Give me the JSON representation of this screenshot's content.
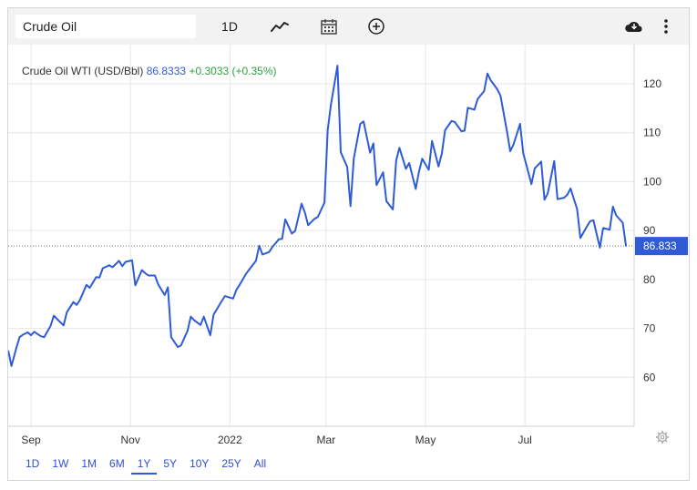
{
  "toolbar": {
    "symbol_value": "Crude Oil",
    "interval_label": "1D",
    "icons": [
      "line-chart-icon",
      "calendar-icon",
      "plus-circle-icon",
      "cloud-download-icon",
      "more-vertical-icon"
    ]
  },
  "legend": {
    "name": "Crude Oil WTI (USD/Bbl)",
    "price": "86.8333",
    "change": "+0.3033 (+0.35%)"
  },
  "last_price_label": "86.833",
  "ranges": [
    {
      "label": "1D",
      "active": false
    },
    {
      "label": "1W",
      "active": false
    },
    {
      "label": "1M",
      "active": false
    },
    {
      "label": "6M",
      "active": false
    },
    {
      "label": "1Y",
      "active": true
    },
    {
      "label": "5Y",
      "active": false
    },
    {
      "label": "10Y",
      "active": false
    },
    {
      "label": "25Y",
      "active": false
    },
    {
      "label": "All",
      "active": false
    }
  ],
  "colors": {
    "line": "#2f5cd6",
    "accent": "#2f5cd6",
    "positive": "#2ea043",
    "grid": "#e6e6e6"
  },
  "chart_data": {
    "type": "line",
    "title": "Crude Oil WTI (USD/Bbl)",
    "xlabel": "",
    "ylabel": "",
    "ylim": [
      50,
      128
    ],
    "y_ticks": [
      60,
      70,
      80,
      90,
      100,
      110,
      120
    ],
    "x_ticks": [
      {
        "date": "2021-09-01",
        "label": "Sep"
      },
      {
        "date": "2021-11-01",
        "label": "Nov"
      },
      {
        "date": "2022-01-01",
        "label": "2022"
      },
      {
        "date": "2022-03-01",
        "label": "Mar"
      },
      {
        "date": "2022-05-01",
        "label": "May"
      },
      {
        "date": "2022-07-01",
        "label": "Jul"
      }
    ],
    "grid": true,
    "last_value": 86.833,
    "series": [
      {
        "points": [
          [
            "2021-08-18",
            65.5
          ],
          [
            "2021-08-20",
            62.3
          ],
          [
            "2021-08-23",
            66.0
          ],
          [
            "2021-08-25",
            68.2
          ],
          [
            "2021-08-27",
            68.7
          ],
          [
            "2021-08-30",
            69.2
          ],
          [
            "2021-09-01",
            68.6
          ],
          [
            "2021-09-03",
            69.3
          ],
          [
            "2021-09-07",
            68.4
          ],
          [
            "2021-09-09",
            68.2
          ],
          [
            "2021-09-13",
            70.5
          ],
          [
            "2021-09-15",
            72.6
          ],
          [
            "2021-09-17",
            71.9
          ],
          [
            "2021-09-21",
            70.6
          ],
          [
            "2021-09-23",
            73.3
          ],
          [
            "2021-09-27",
            75.4
          ],
          [
            "2021-09-29",
            74.8
          ],
          [
            "2021-10-01",
            75.8
          ],
          [
            "2021-10-05",
            78.9
          ],
          [
            "2021-10-07",
            78.3
          ],
          [
            "2021-10-11",
            80.5
          ],
          [
            "2021-10-13",
            80.4
          ],
          [
            "2021-10-15",
            82.3
          ],
          [
            "2021-10-19",
            82.9
          ],
          [
            "2021-10-21",
            82.5
          ],
          [
            "2021-10-25",
            83.8
          ],
          [
            "2021-10-27",
            82.7
          ],
          [
            "2021-10-29",
            83.6
          ],
          [
            "2021-11-02",
            83.9
          ],
          [
            "2021-11-04",
            78.8
          ],
          [
            "2021-11-08",
            81.9
          ],
          [
            "2021-11-10",
            81.3
          ],
          [
            "2021-11-12",
            80.8
          ],
          [
            "2021-11-16",
            80.8
          ],
          [
            "2021-11-18",
            79.0
          ],
          [
            "2021-11-22",
            76.8
          ],
          [
            "2021-11-24",
            78.4
          ],
          [
            "2021-11-26",
            68.2
          ],
          [
            "2021-11-30",
            66.2
          ],
          [
            "2021-12-02",
            66.5
          ],
          [
            "2021-12-06",
            69.5
          ],
          [
            "2021-12-08",
            72.4
          ],
          [
            "2021-12-10",
            71.7
          ],
          [
            "2021-12-14",
            70.7
          ],
          [
            "2021-12-16",
            72.4
          ],
          [
            "2021-12-20",
            68.6
          ],
          [
            "2021-12-22",
            72.8
          ],
          [
            "2021-12-27",
            75.6
          ],
          [
            "2021-12-29",
            76.6
          ],
          [
            "2022-01-03",
            76.1
          ],
          [
            "2022-01-05",
            77.9
          ],
          [
            "2022-01-07",
            78.9
          ],
          [
            "2022-01-11",
            81.2
          ],
          [
            "2022-01-13",
            82.1
          ],
          [
            "2022-01-17",
            83.8
          ],
          [
            "2022-01-19",
            86.9
          ],
          [
            "2022-01-21",
            85.1
          ],
          [
            "2022-01-25",
            85.6
          ],
          [
            "2022-01-27",
            86.6
          ],
          [
            "2022-01-31",
            88.2
          ],
          [
            "2022-02-02",
            88.3
          ],
          [
            "2022-02-04",
            92.3
          ],
          [
            "2022-02-08",
            89.4
          ],
          [
            "2022-02-10",
            89.9
          ],
          [
            "2022-02-14",
            95.5
          ],
          [
            "2022-02-16",
            93.7
          ],
          [
            "2022-02-18",
            91.1
          ],
          [
            "2022-02-22",
            92.4
          ],
          [
            "2022-02-24",
            92.8
          ],
          [
            "2022-02-28",
            95.7
          ],
          [
            "2022-03-02",
            110.6
          ],
          [
            "2022-03-04",
            115.7
          ],
          [
            "2022-03-08",
            123.7
          ],
          [
            "2022-03-10",
            106.0
          ],
          [
            "2022-03-14",
            103.0
          ],
          [
            "2022-03-16",
            95.0
          ],
          [
            "2022-03-18",
            104.7
          ],
          [
            "2022-03-22",
            111.8
          ],
          [
            "2022-03-24",
            112.3
          ],
          [
            "2022-03-28",
            105.9
          ],
          [
            "2022-03-30",
            107.8
          ],
          [
            "2022-04-01",
            99.3
          ],
          [
            "2022-04-05",
            101.9
          ],
          [
            "2022-04-07",
            96.0
          ],
          [
            "2022-04-11",
            94.3
          ],
          [
            "2022-04-13",
            104.3
          ],
          [
            "2022-04-15",
            106.9
          ],
          [
            "2022-04-19",
            102.6
          ],
          [
            "2022-04-21",
            103.8
          ],
          [
            "2022-04-25",
            98.5
          ],
          [
            "2022-04-27",
            102.0
          ],
          [
            "2022-04-29",
            104.7
          ],
          [
            "2022-05-03",
            102.4
          ],
          [
            "2022-05-05",
            108.3
          ],
          [
            "2022-05-09",
            103.1
          ],
          [
            "2022-05-11",
            105.7
          ],
          [
            "2022-05-13",
            110.5
          ],
          [
            "2022-05-17",
            112.4
          ],
          [
            "2022-05-19",
            112.2
          ],
          [
            "2022-05-23",
            110.3
          ],
          [
            "2022-05-25",
            110.4
          ],
          [
            "2022-05-27",
            115.1
          ],
          [
            "2022-05-31",
            114.7
          ],
          [
            "2022-06-02",
            116.9
          ],
          [
            "2022-06-06",
            118.5
          ],
          [
            "2022-06-08",
            122.1
          ],
          [
            "2022-06-10",
            120.7
          ],
          [
            "2022-06-14",
            118.9
          ],
          [
            "2022-06-16",
            117.6
          ],
          [
            "2022-06-20",
            110.2
          ],
          [
            "2022-06-22",
            106.2
          ],
          [
            "2022-06-24",
            107.6
          ],
          [
            "2022-06-28",
            111.8
          ],
          [
            "2022-06-30",
            105.8
          ],
          [
            "2022-07-05",
            99.5
          ],
          [
            "2022-07-07",
            102.7
          ],
          [
            "2022-07-11",
            104.1
          ],
          [
            "2022-07-13",
            96.3
          ],
          [
            "2022-07-15",
            97.6
          ],
          [
            "2022-07-19",
            104.2
          ],
          [
            "2022-07-21",
            96.4
          ],
          [
            "2022-07-25",
            96.7
          ],
          [
            "2022-07-27",
            97.3
          ],
          [
            "2022-07-29",
            98.6
          ],
          [
            "2022-08-02",
            94.4
          ],
          [
            "2022-08-04",
            88.5
          ],
          [
            "2022-08-08",
            90.8
          ],
          [
            "2022-08-10",
            91.9
          ],
          [
            "2022-08-12",
            92.1
          ],
          [
            "2022-08-16",
            86.5
          ],
          [
            "2022-08-18",
            90.5
          ],
          [
            "2022-08-22",
            90.2
          ],
          [
            "2022-08-24",
            94.9
          ],
          [
            "2022-08-26",
            93.1
          ],
          [
            "2022-08-30",
            91.6
          ],
          [
            "2022-09-01",
            86.8
          ]
        ]
      }
    ]
  }
}
